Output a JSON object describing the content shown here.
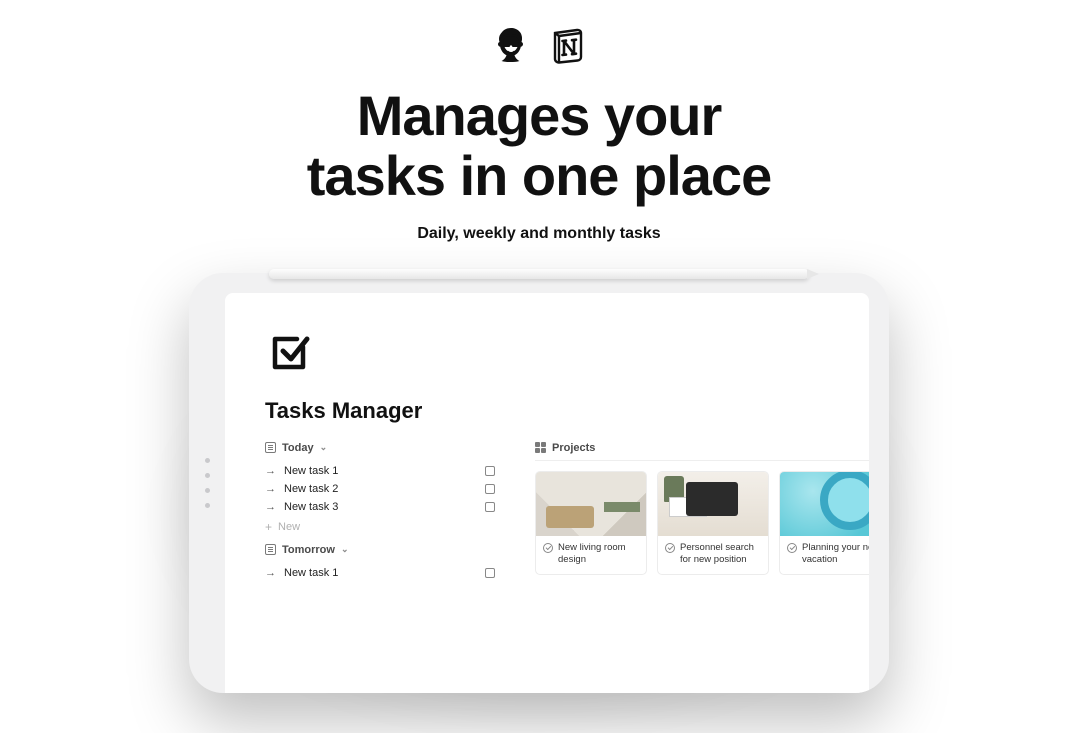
{
  "hero": {
    "headline_line1": "Manages your",
    "headline_line2": "tasks in one place",
    "subhead": "Daily, weekly and monthly tasks"
  },
  "page": {
    "title": "Tasks Manager"
  },
  "sections": {
    "today": {
      "label": "Today",
      "tasks": [
        {
          "label": "New task 1"
        },
        {
          "label": "New task 2"
        },
        {
          "label": "New task 3"
        }
      ],
      "new_label": "New"
    },
    "tomorrow": {
      "label": "Tomorrow",
      "tasks": [
        {
          "label": "New task 1"
        }
      ]
    }
  },
  "projects": {
    "header": "Projects",
    "cards": [
      {
        "title": "New living room design"
      },
      {
        "title": "Personnel search for new position"
      },
      {
        "title": "Planning your next vacation"
      }
    ]
  }
}
